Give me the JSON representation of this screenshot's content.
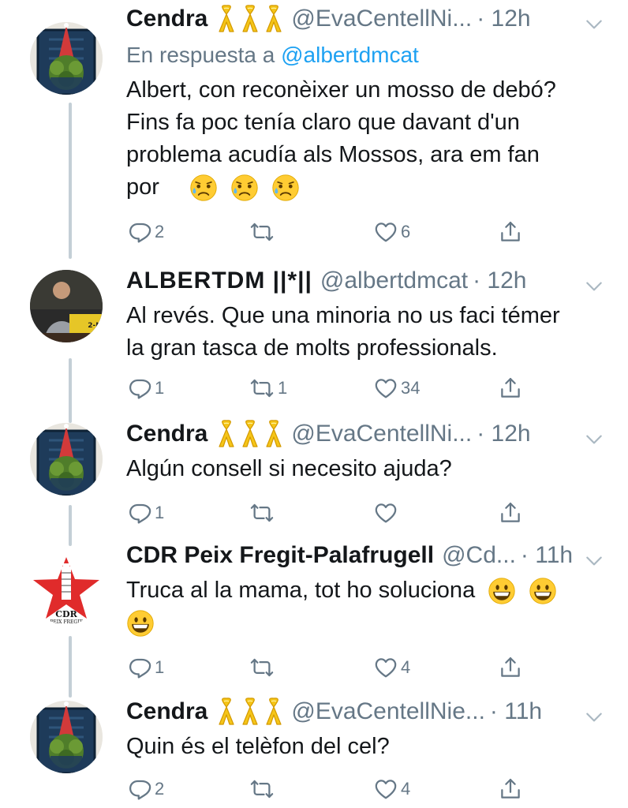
{
  "tweets": [
    {
      "name": "Cendra",
      "handle": "@EvaCentellNi...",
      "time": "· 12h",
      "reply_prefix": "En respuesta a ",
      "reply_to": "@albertdmcat",
      "lines": [
        "Albert, con reconèixer un mosso de debó?",
        "Fins fa poc tenía claro que davant d'un",
        "problema acudía als Mossos, ara em fan",
        "por"
      ],
      "replies": "2",
      "retweets": "",
      "likes": "6"
    },
    {
      "name": "ALBERTDM ||*||",
      "handle": "@albertdmcat",
      "time": "· 12h",
      "lines": [
        "Al revés. Que una minoria no us faci témer",
        "la gran tasca de molts professionals."
      ],
      "replies": "1",
      "retweets": "1",
      "likes": "34",
      "avatar_text": "2-N"
    },
    {
      "name": "Cendra",
      "handle": "@EvaCentellNi...",
      "time": "· 12h",
      "lines": [
        "Algún consell si necesito ajuda?"
      ],
      "replies": "1",
      "retweets": "",
      "likes": ""
    },
    {
      "name": "CDR Peix Fregit-Palafrugell",
      "handle": "@Cd...",
      "time": "· 11h",
      "lines": [
        "Truca al la mama, tot ho soluciona"
      ],
      "replies": "1",
      "retweets": "",
      "likes": "4",
      "avatar_text": "CDR",
      "avatar_subtext": "PEIX FREGIT"
    },
    {
      "name": "Cendra",
      "handle": "@EvaCentellNie...",
      "time": "· 11h",
      "lines": [
        "Quin és el telèfon del cel?"
      ],
      "replies": "2",
      "retweets": "",
      "likes": "4"
    }
  ],
  "avatar_caption": "BON NADAL",
  "colors": {
    "text": "#14171a",
    "muted": "#657786",
    "link": "#1da1f2",
    "ribbon": "#f5c518",
    "thread": "#c4cfd6"
  },
  "icons": [
    "reply-icon",
    "retweet-icon",
    "like-icon",
    "share-icon",
    "chevron-down-icon",
    "yellow-ribbon-icon",
    "sad-sweat-emoji",
    "grinning-emoji"
  ]
}
